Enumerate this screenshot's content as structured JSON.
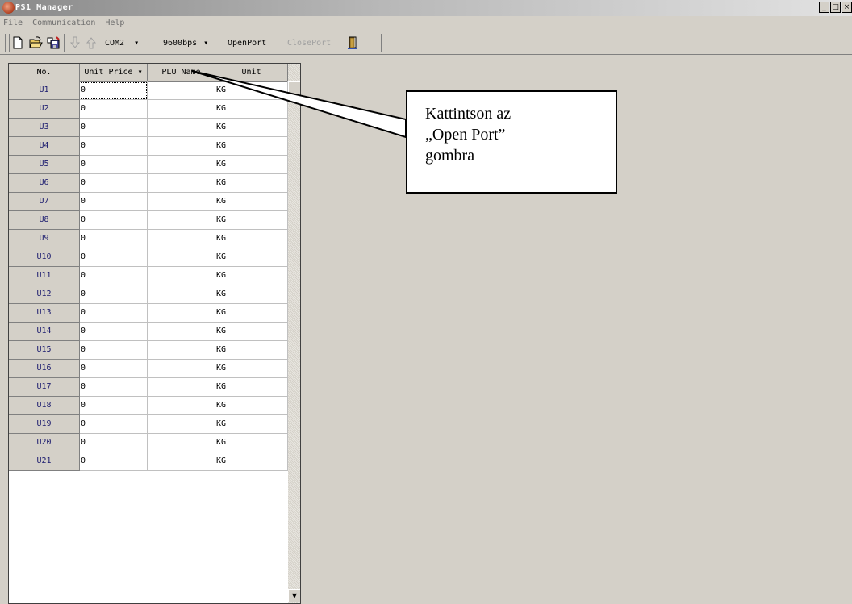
{
  "window": {
    "title": "PS1 Manager",
    "controls": [
      "_",
      "□",
      "×"
    ]
  },
  "menu": [
    {
      "label": "File"
    },
    {
      "label": "Communication"
    },
    {
      "label": "Help"
    }
  ],
  "toolbar": {
    "new_icon": "new-file-icon",
    "open_icon": "open-folder-icon",
    "save_icon": "save-icon",
    "download_icon": "arrow-down-icon",
    "upload_icon": "arrow-up-icon",
    "port_value": "COM2",
    "baud_value": "9600bps",
    "open_port_label": "OpenPort",
    "close_port_label": "ClosePort",
    "exit_icon": "exit-door-icon"
  },
  "grid": {
    "columns": [
      "No.",
      "Unit Price",
      "PLU Name",
      "Unit"
    ],
    "rows": [
      {
        "no": "U1",
        "price": "0",
        "name": "",
        "unit": "KG"
      },
      {
        "no": "U2",
        "price": "0",
        "name": "",
        "unit": "KG"
      },
      {
        "no": "U3",
        "price": "0",
        "name": "",
        "unit": "KG"
      },
      {
        "no": "U4",
        "price": "0",
        "name": "",
        "unit": "KG"
      },
      {
        "no": "U5",
        "price": "0",
        "name": "",
        "unit": "KG"
      },
      {
        "no": "U6",
        "price": "0",
        "name": "",
        "unit": "KG"
      },
      {
        "no": "U7",
        "price": "0",
        "name": "",
        "unit": "KG"
      },
      {
        "no": "U8",
        "price": "0",
        "name": "",
        "unit": "KG"
      },
      {
        "no": "U9",
        "price": "0",
        "name": "",
        "unit": "KG"
      },
      {
        "no": "U10",
        "price": "0",
        "name": "",
        "unit": "KG"
      },
      {
        "no": "U11",
        "price": "0",
        "name": "",
        "unit": "KG"
      },
      {
        "no": "U12",
        "price": "0",
        "name": "",
        "unit": "KG"
      },
      {
        "no": "U13",
        "price": "0",
        "name": "",
        "unit": "KG"
      },
      {
        "no": "U14",
        "price": "0",
        "name": "",
        "unit": "KG"
      },
      {
        "no": "U15",
        "price": "0",
        "name": "",
        "unit": "KG"
      },
      {
        "no": "U16",
        "price": "0",
        "name": "",
        "unit": "KG"
      },
      {
        "no": "U17",
        "price": "0",
        "name": "",
        "unit": "KG"
      },
      {
        "no": "U18",
        "price": "0",
        "name": "",
        "unit": "KG"
      },
      {
        "no": "U19",
        "price": "0",
        "name": "",
        "unit": "KG"
      },
      {
        "no": "U20",
        "price": "0",
        "name": "",
        "unit": "KG"
      },
      {
        "no": "U21",
        "price": "0",
        "name": "",
        "unit": "KG"
      }
    ]
  },
  "callout": {
    "lines": [
      "Kattintson az",
      "„Open Port”",
      "gombra"
    ]
  },
  "colors": {
    "face": "#d4d0c8",
    "row_header_text": "#1a1a6e",
    "disabled_text": "#a0a0a0"
  }
}
